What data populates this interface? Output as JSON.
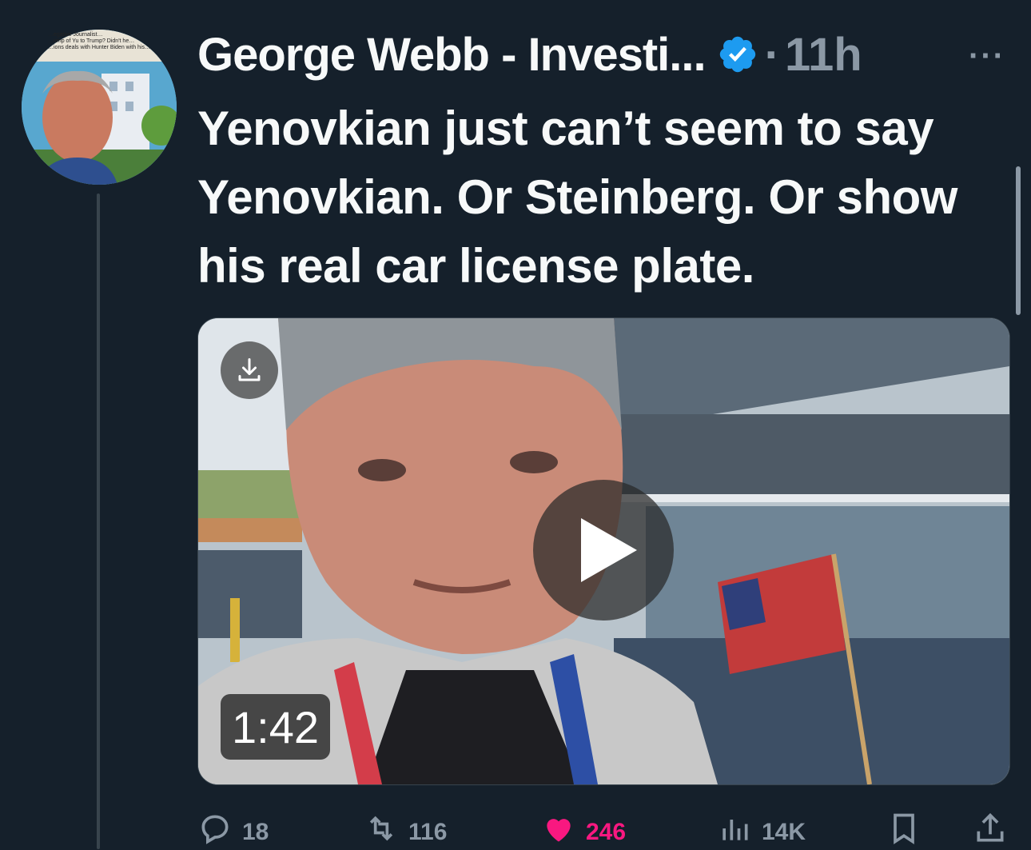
{
  "post": {
    "author_name": "George Webb - Investi...",
    "separator": "·",
    "time": "11h",
    "more_label": "···",
    "text": "Yenovkian just can’t seem to say Yenovkian. Or Steinberg. Or show his real car license plate.",
    "avatar_caption": [
      "…egative Journalist…",
      "…ump of Yu to Trump? Didn't he…",
      "…ions deals with Hunter Biden with his…"
    ],
    "verified_icon": "verified-badge-icon"
  },
  "media": {
    "type": "video",
    "duration": "1:42",
    "download_icon": "download-icon",
    "play_icon": "play-icon"
  },
  "actions": {
    "reply_count": "18",
    "repost_count": "116",
    "like_count": "246",
    "views_count": "14K",
    "colors": {
      "muted": "#8b98a5",
      "liked": "#f91880",
      "verified": "#1d9bf0"
    }
  }
}
